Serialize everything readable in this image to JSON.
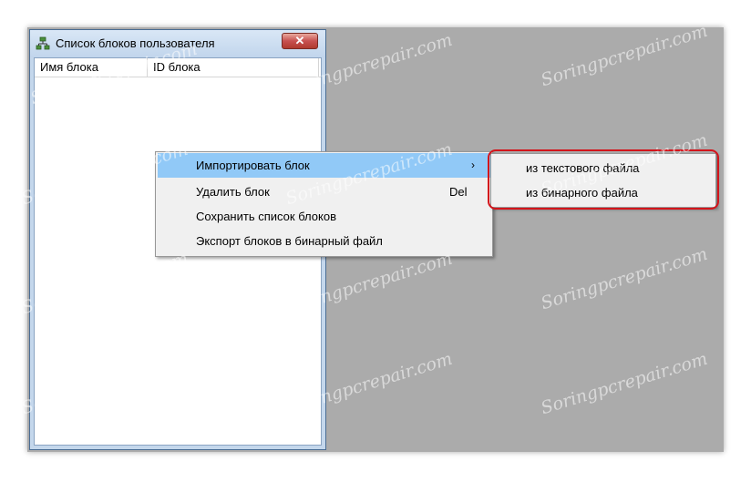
{
  "window": {
    "title": "Список блоков пользователя",
    "close_label": "✕",
    "columns": [
      "Имя блока",
      "ID блока"
    ]
  },
  "context_menu": {
    "items": [
      {
        "label": "Импортировать блок",
        "shortcut": "",
        "arrow": "›",
        "highlighted": true
      },
      {
        "label": "Удалить блок",
        "shortcut": "Del",
        "arrow": "",
        "highlighted": false
      },
      {
        "label": "Сохранить список блоков",
        "shortcut": "",
        "arrow": "",
        "highlighted": false
      },
      {
        "label": "Экспорт блоков в бинарный файл",
        "shortcut": "",
        "arrow": "",
        "highlighted": false
      }
    ]
  },
  "submenu": {
    "items": [
      {
        "label": "из текстового файла"
      },
      {
        "label": "из бинарного файла"
      }
    ]
  },
  "watermark": "Soringpcrepair.com",
  "colors": {
    "highlight": "#91c9f7",
    "annotation": "#d3141b",
    "close": "#c75050"
  }
}
